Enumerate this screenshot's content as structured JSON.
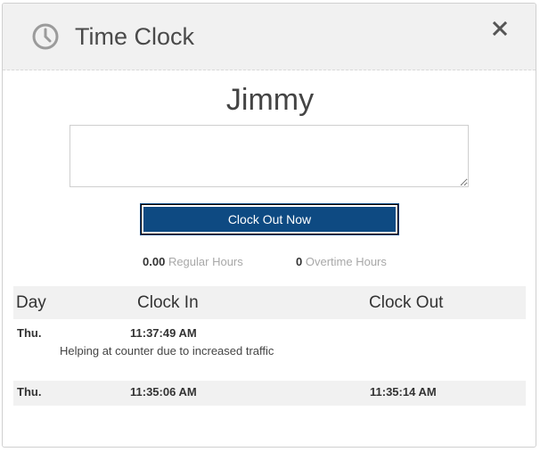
{
  "header": {
    "title": "Time Clock",
    "clock_icon": "clock-icon",
    "close_icon": "close-icon"
  },
  "employee": {
    "name": "Jimmy"
  },
  "note": {
    "value": "",
    "placeholder": ""
  },
  "actions": {
    "clock_out_label": "Clock Out Now",
    "clock_out_color": "#0e4a82"
  },
  "summary": {
    "regular_value": "0.00",
    "regular_label": "Regular Hours",
    "overtime_value": "0",
    "overtime_label": "Overtime Hours"
  },
  "table": {
    "headers": {
      "day": "Day",
      "clock_in": "Clock In",
      "clock_out": "Clock Out"
    },
    "rows": [
      {
        "day": "Thu.",
        "clock_in": "11:37:49 AM",
        "clock_out": "",
        "comment": "Helping at counter due to increased traffic"
      },
      {
        "day": "Thu.",
        "clock_in": "11:35:06 AM",
        "clock_out": "11:35:14 AM",
        "comment": ""
      }
    ]
  }
}
